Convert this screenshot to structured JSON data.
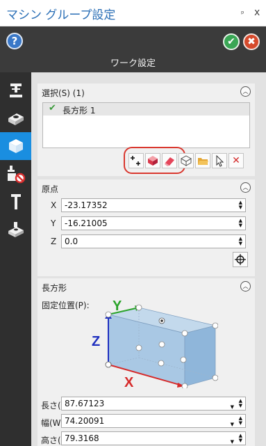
{
  "window": {
    "title": "マシン グループ設定",
    "pin_label": "ᵖ",
    "close_label": "x"
  },
  "header": {
    "help_label": "?",
    "ok_label": "✔",
    "cancel_label": "✖",
    "subtitle": "ワーク設定"
  },
  "rail": {
    "items": [
      {
        "icon": "machine-icon",
        "active": false
      },
      {
        "icon": "stock-icon",
        "active": false
      },
      {
        "icon": "work-setup-icon",
        "active": true
      },
      {
        "icon": "safety-zone-icon",
        "active": false
      },
      {
        "icon": "tool-settings-icon",
        "active": false
      },
      {
        "icon": "fixture-icon",
        "active": false
      }
    ]
  },
  "selection": {
    "header": "選択(S)  (1)",
    "items": [
      {
        "label": "長方形 1",
        "checked": true
      }
    ],
    "toolbar": [
      "add-selection-icon",
      "solid-select-icon",
      "eraser-icon",
      "wireframe-box-icon",
      "open-folder-icon",
      "pointer-icon",
      "remove-icon"
    ],
    "remove_label": "✕"
  },
  "origin": {
    "header": "原点",
    "fields": [
      {
        "label": "X",
        "value": "-23.17352"
      },
      {
        "label": "Y",
        "value": "-16.21005"
      },
      {
        "label": "Z",
        "value": "0.0"
      }
    ]
  },
  "rectangle": {
    "header": "長方形",
    "fixed_position_label": "固定位置(P):",
    "axis_labels": {
      "x": "X",
      "y": "Y",
      "z": "Z"
    },
    "fields": [
      {
        "label": "長さ(L):",
        "value": "87.67123"
      },
      {
        "label": "幅(W):",
        "value": "74.20091"
      },
      {
        "label": "高さ(H):",
        "value": "79.3168"
      }
    ]
  },
  "colors": {
    "accent": "#1a8ee0",
    "title": "#2b6fb6",
    "highlight": "#d9372e",
    "rail": "#2f2f2f",
    "header": "#3b3b3b"
  }
}
